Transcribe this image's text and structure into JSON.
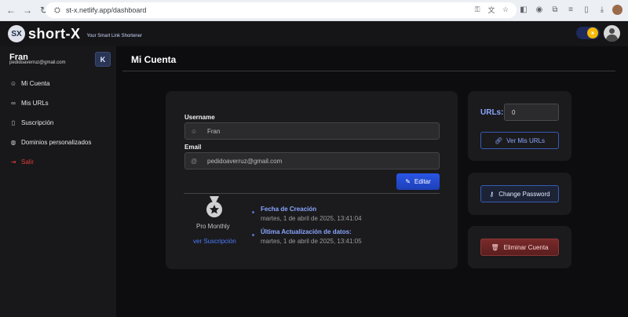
{
  "browser": {
    "url": "st-x.netlify.app/dashboard",
    "nav_icons": [
      "arrow-left-icon",
      "arrow-right-icon",
      "reload-icon"
    ]
  },
  "header": {
    "logo_badge": "SX",
    "logo_text": "short-X",
    "tagline": "Your Smart Link Shortener"
  },
  "sidebar": {
    "user_name": "Fran",
    "user_email": "pedidoaverruz@gmail.com",
    "collapse_label": "K",
    "items": [
      {
        "label": "Mi Cuenta",
        "icon": "user-icon"
      },
      {
        "label": "Mis URLs",
        "icon": "link-icon"
      },
      {
        "label": "Suscripción",
        "icon": "bookmark-icon"
      },
      {
        "label": "Dominios personalizados",
        "icon": "globe-icon"
      },
      {
        "label": "Salir",
        "icon": "logout-icon"
      }
    ]
  },
  "main": {
    "title": "Mi Cuenta",
    "username_label": "Username",
    "username_value": "Fran",
    "email_label": "Email",
    "email_value": "pedidoaverruz@gmail.com",
    "edit_label": "Editar",
    "plan_name": "Pro Monthly",
    "plan_link": "ver Suscripción",
    "created_label": "Fecha de Creación",
    "created_value": "martes, 1 de abril de 2025, 13:41:04",
    "updated_label": "Última Actualización de datos:",
    "updated_value": "martes, 1 de abril de 2025, 13:41:05"
  },
  "urls_card": {
    "label": "URLs:",
    "value": "0",
    "button_label": "Ver Mis URLs"
  },
  "password_card": {
    "button_label": "Change Password"
  },
  "delete_card": {
    "button_label": "Eliminar Cuenta"
  },
  "colors": {
    "accent": "#2a56e6",
    "link": "#8aa6ff",
    "danger": "#e23b3b",
    "background": "#0d0d0f"
  }
}
